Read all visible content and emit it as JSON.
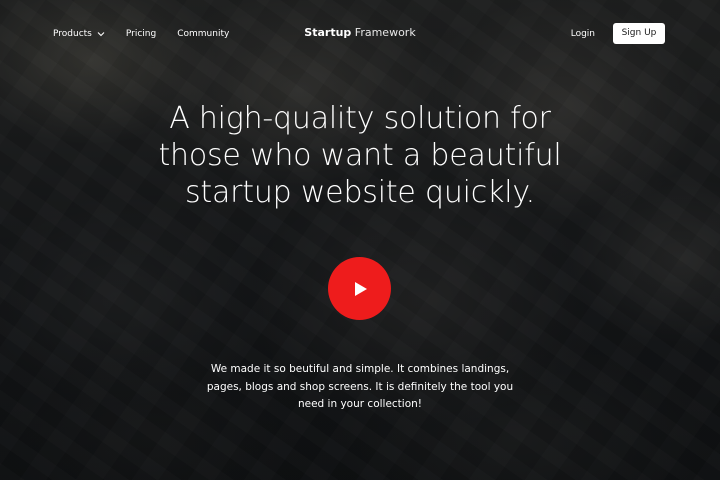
{
  "nav": {
    "products_label": "Products",
    "pricing_label": "Pricing",
    "community_label": "Community",
    "brand_bold": "Startup",
    "brand_light": "Framework",
    "login_label": "Login",
    "signup_label": "Sign Up"
  },
  "hero": {
    "title_lines": [
      "A high-quality solution for",
      "those who want a beautiful",
      "startup website quickly."
    ],
    "description_lines": [
      "We made it so beutiful and simple. It combines landings,",
      "pages, blogs and shop screens. It is definitely the tool you",
      "need in your collection!"
    ],
    "play_icon": "play-icon"
  },
  "colors": {
    "play_button": "#ee1c1c",
    "signup_bg": "#ffffff",
    "text": "#ffffff"
  }
}
